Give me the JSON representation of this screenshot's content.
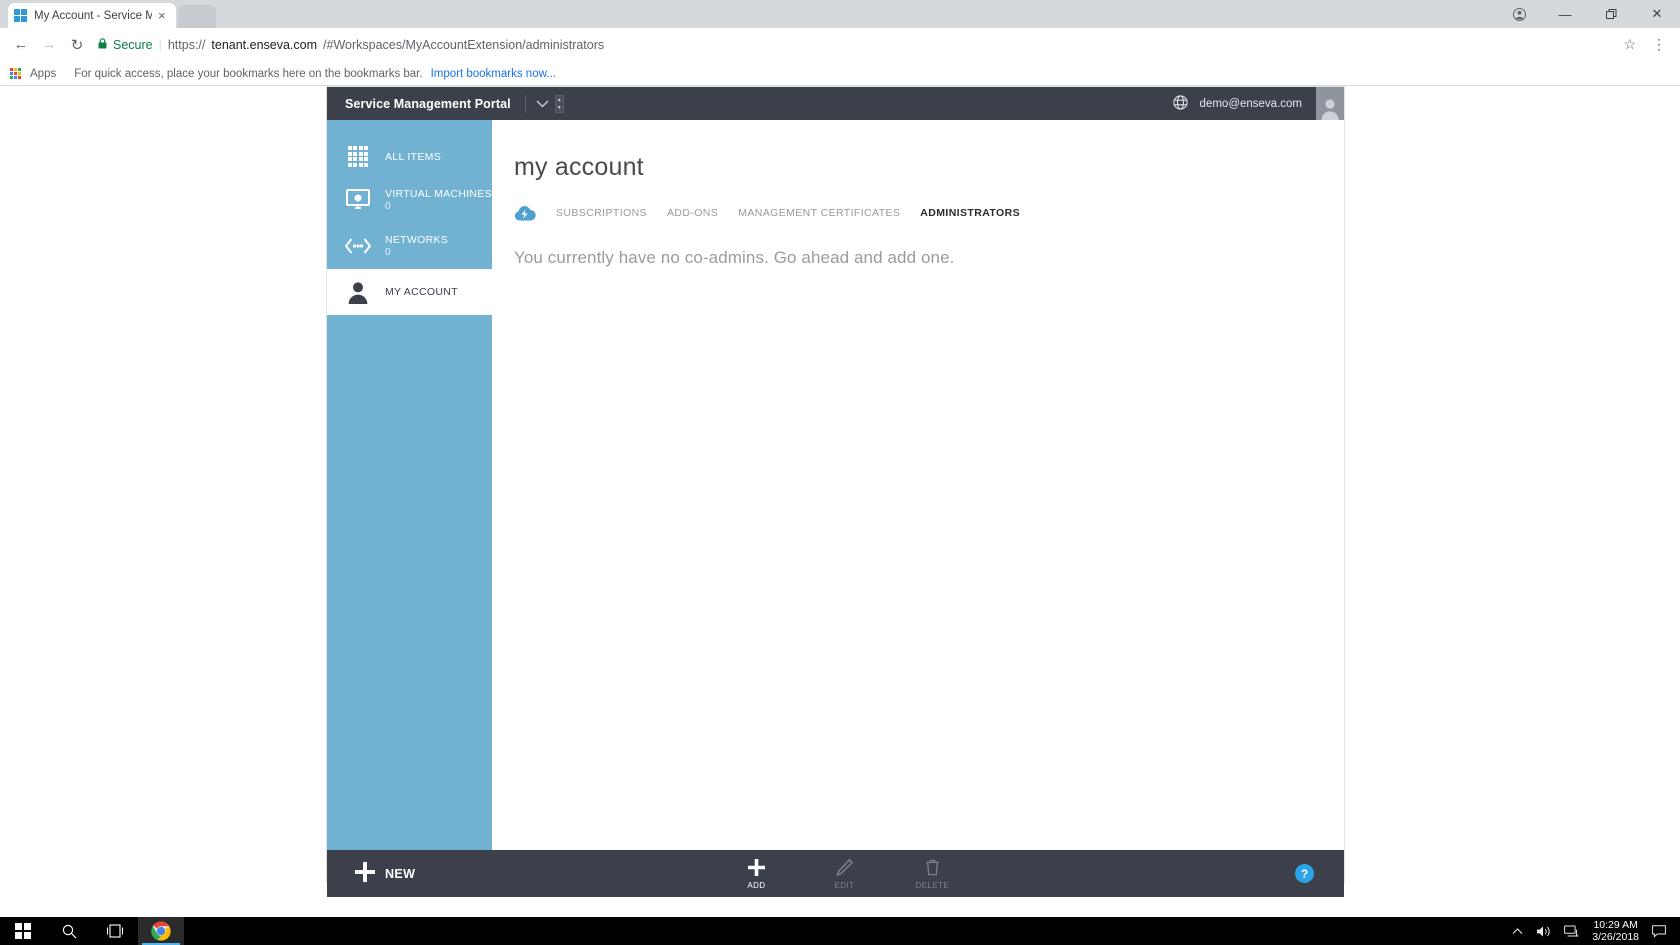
{
  "browser": {
    "tab": {
      "title": "My Account - Service Ma",
      "close_label": "×",
      "favicon": "windows-logo-icon"
    },
    "nav": {
      "back": "←",
      "forward": "→",
      "reload": "↻"
    },
    "address": {
      "lock_icon": "lock-icon",
      "secure_label": "Secure",
      "separator": "|",
      "scheme": "https://",
      "domain": "tenant.enseva.com",
      "path": "/#Workspaces/MyAccountExtension/administrators",
      "star_icon": "☆",
      "menu_icon": "⋮"
    },
    "bookmarks": {
      "apps_label": "Apps",
      "hint": "For quick access, place your bookmarks here on the bookmarks bar.",
      "import_link": "Import bookmarks now..."
    },
    "window_controls": {
      "profile": "●",
      "minimize": "—",
      "maximize": "❐",
      "close": "✕"
    }
  },
  "portal": {
    "header": {
      "title": "Service Management Portal",
      "chevron": "⌄",
      "spin_up": "▲",
      "spin_down": "▼",
      "globe_icon": "globe-icon",
      "user_email": "demo@enseva.com",
      "avatar": "user-avatar-icon"
    },
    "sidebar": {
      "items": [
        {
          "label": "ALL ITEMS",
          "count": "",
          "icon": "grid-icon"
        },
        {
          "label": "VIRTUAL MACHINES",
          "count": "0",
          "icon": "monitor-icon"
        },
        {
          "label": "NETWORKS",
          "count": "0",
          "icon": "network-icon"
        },
        {
          "label": "MY ACCOUNT",
          "count": "",
          "icon": "person-icon"
        }
      ]
    },
    "main": {
      "page_title": "my account",
      "cloud_icon": "cloud-bolt-icon",
      "tabs": [
        {
          "label": "SUBSCRIPTIONS",
          "active": false
        },
        {
          "label": "ADD-ONS",
          "active": false
        },
        {
          "label": "MANAGEMENT CERTIFICATES",
          "active": false
        },
        {
          "label": "ADMINISTRATORS",
          "active": true
        }
      ],
      "empty_message": "You currently have no co-admins. Go ahead and add one."
    },
    "commandbar": {
      "new_label": "NEW",
      "new_icon": "plus-icon",
      "actions": [
        {
          "label": "ADD",
          "icon": "plus-icon",
          "enabled": true
        },
        {
          "label": "EDIT",
          "icon": "pencil-icon",
          "enabled": false
        },
        {
          "label": "DELETE",
          "icon": "trash-icon",
          "enabled": false
        }
      ],
      "help_label": "?"
    },
    "colors": {
      "header_bg": "#3b404a",
      "sidebar_bg": "#71b2d3",
      "accent": "#2aa3e8"
    }
  },
  "taskbar": {
    "start_icon": "windows-start-icon",
    "search_icon": "search-icon",
    "taskview_icon": "task-view-icon",
    "chrome_icon": "chrome-icon",
    "tray": {
      "chevron": "∧",
      "volume_icon": "volume-icon",
      "network_icon": "network-icon",
      "time": "10:29 AM",
      "date": "3/26/2018",
      "action_center_icon": "action-center-icon"
    }
  }
}
